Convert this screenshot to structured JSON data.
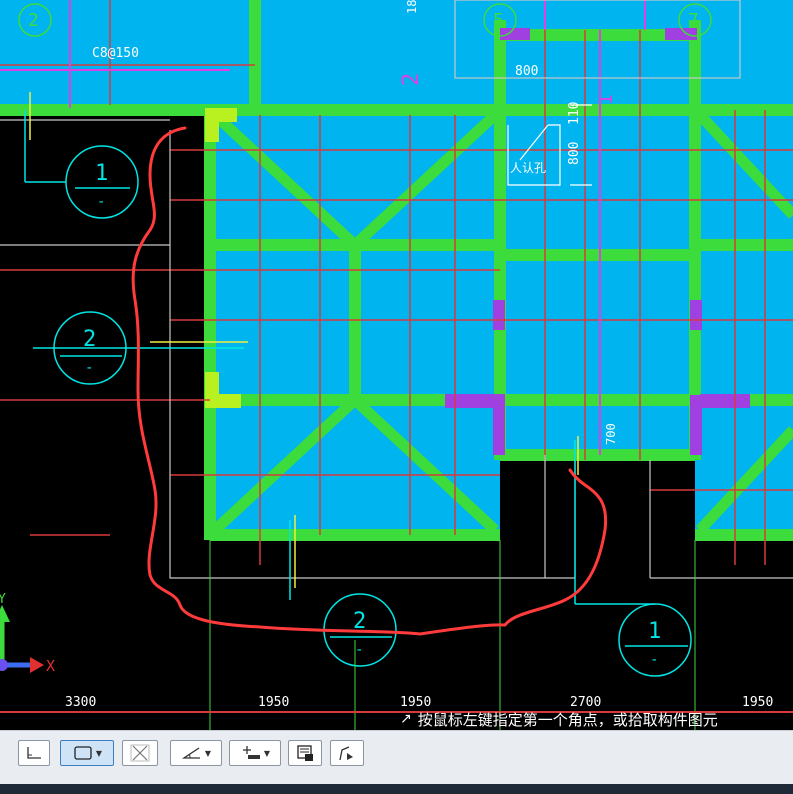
{
  "drawing": {
    "grid_labels_top": [
      "2",
      "5",
      "7"
    ],
    "grid_labels_bottom": [
      "1",
      "2",
      "2",
      "1"
    ],
    "grid_labels_bottom_sub": [
      "-",
      "-",
      "-",
      "-"
    ],
    "rebar_label": "C8@150",
    "dimension_top": "800",
    "dimension_side": "800",
    "dimension_side2": "700",
    "opening_text": "人认孔",
    "opening_code": "110",
    "bottom_dimensions": [
      "3300",
      "1950",
      "1950",
      "2700",
      "1950"
    ],
    "top_fragment": "18",
    "section_mark": "1",
    "section_mark_2": "2"
  },
  "status": {
    "prompt": "按鼠标左键指定第一个角点，或拾取构件图元"
  },
  "axis": {
    "x_label": "X",
    "y_label": "Y"
  },
  "colors": {
    "background": "#000000",
    "fill_blue": "#00b4f0",
    "beam_green": "#3cdc3c",
    "grid_line": "#c8c8c8",
    "red_line": "#d83a3a",
    "magenta_line": "#e040e0",
    "annotation_red": "#ff3b3b",
    "cyan": "#00e5e5"
  },
  "toolbar": {
    "tools": [
      "orthogonal-tool",
      "rectangle-select-tool",
      "cross-select-tool",
      "angle-tool",
      "snap-tool",
      "layer-tool",
      "polyline-tool"
    ]
  }
}
